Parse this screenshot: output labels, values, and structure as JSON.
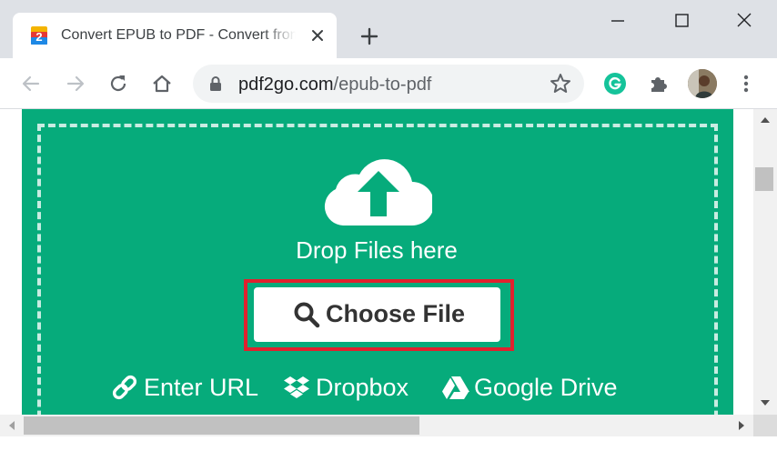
{
  "browser": {
    "tab": {
      "title": "Convert EPUB to PDF - Convert from EPUB to PDF",
      "favicon": "pdf2go-favicon"
    },
    "window_controls": [
      "minimize-icon",
      "maximize-icon",
      "close-icon"
    ],
    "toolbar": {
      "url_host": "pdf2go.com",
      "url_path": "/epub-to-pdf",
      "icons": [
        "back-arrow-icon",
        "forward-arrow-icon",
        "reload-icon",
        "home-icon",
        "lock-icon",
        "star-icon",
        "grammarly-icon",
        "extensions-icon",
        "avatar",
        "kebab-menu-icon"
      ]
    }
  },
  "page": {
    "drop_text": "Drop Files here",
    "choose_file_label": "Choose File",
    "sources": [
      {
        "label": "Enter URL",
        "icon": "link-icon"
      },
      {
        "label": "Dropbox",
        "icon": "dropbox-icon"
      },
      {
        "label": "Google Drive",
        "icon": "google-drive-icon"
      }
    ]
  },
  "colors": {
    "accent_green": "#06ab7b",
    "highlight_red": "#e0212e",
    "grammarly_green": "#15c39a",
    "tab_strip": "#dee1e6"
  }
}
